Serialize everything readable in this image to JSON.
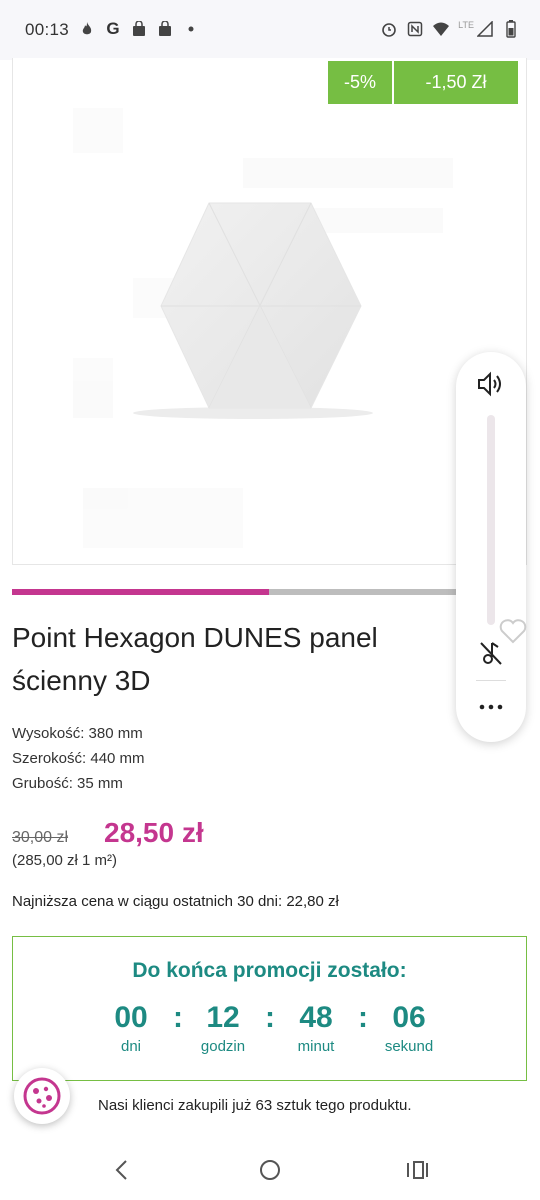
{
  "status_bar": {
    "time": "00:13",
    "left_icons": [
      "fire-icon",
      "google-icon",
      "shopping-bag-icon",
      "shopping-bag-icon",
      "dot-icon"
    ],
    "right_icons": [
      "alarm-icon",
      "nfc-icon",
      "wifi-icon",
      "signal-icon",
      "battery-icon"
    ],
    "network": "LTE"
  },
  "product": {
    "badges": {
      "percent": "-5%",
      "amount": "-1,50 Zł"
    },
    "title": "Point Hexagon DUNES panel ścienny 3D",
    "specs": [
      "Wysokość: 380 mm",
      "Szerokość: 440 mm",
      "Grubość: 35 mm"
    ],
    "old_price": "30,00 zł",
    "new_price": "28,50 zł",
    "unit_price": "(285,00 zł 1 m²)",
    "lowest_price": "Najniższa cena w ciągu ostatnich 30 dni: 22,80 zł",
    "gallery_progress": 0.5
  },
  "countdown": {
    "title": "Do końca promocji zostało:",
    "days": "00",
    "hours": "12",
    "minutes": "48",
    "seconds": "06",
    "labels": {
      "days": "dni",
      "hours": "godzin",
      "minutes": "minut",
      "seconds": "sekund"
    },
    "separator": ":"
  },
  "customers_text": "Nasi klienci zakupili już 63 sztuk tego produktu.",
  "volume_panel": {
    "icons": [
      "volume-icon",
      "ring-off-icon",
      "more-icon"
    ]
  },
  "nav": {
    "icons": [
      "back-icon",
      "home-icon",
      "recents-icon"
    ]
  },
  "colors": {
    "accent": "#c4368f",
    "badge": "#76be43",
    "countdown": "#1d8a82"
  }
}
